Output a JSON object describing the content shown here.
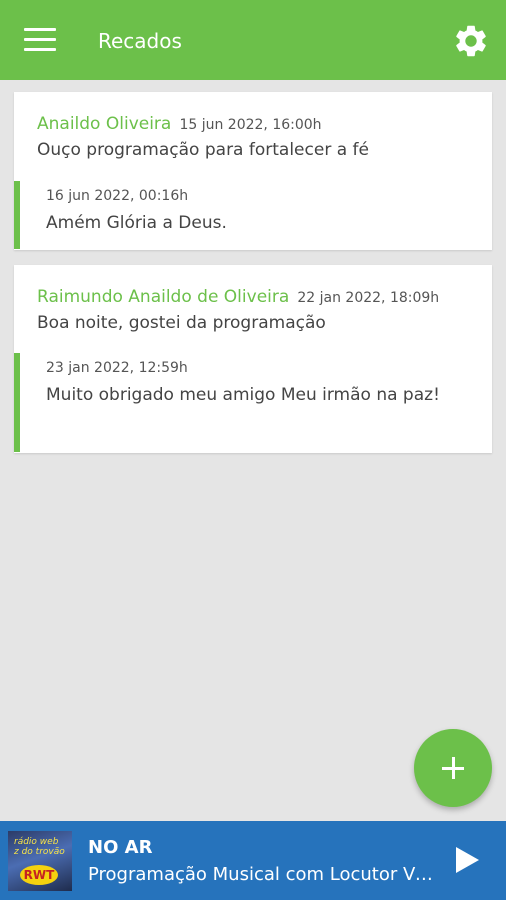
{
  "appbar": {
    "title": "Recados",
    "menu_icon": "menu-icon",
    "settings_icon": "gear-icon",
    "color": "#6cc04a"
  },
  "messages": [
    {
      "author": "Anaildo Oliveira",
      "date": "15 jun 2022, 16:00h",
      "text": "Ouço programação para fortalecer a  fé",
      "reply": {
        "date": "16 jun 2022, 00:16h",
        "text": "Amém Glória a Deus."
      }
    },
    {
      "author": "Raimundo Anaildo de Oliveira",
      "date": "22 jan 2022, 18:09h",
      "text": "Boa noite, gostei da programação",
      "reply": {
        "date": "23 jan 2022, 12:59h",
        "text": "Muito obrigado meu amigo Meu irmão na paz!"
      }
    }
  ],
  "fab": {
    "icon": "plus-icon"
  },
  "player": {
    "status": "NO AR",
    "now_playing": "Programação Musical com Locutor Virtual",
    "play_icon": "play-icon",
    "color": "#2673bc"
  }
}
